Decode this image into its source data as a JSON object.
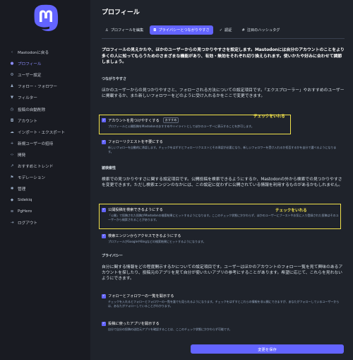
{
  "sidebar": {
    "back_label": "Mastodonに戻る",
    "items": [
      {
        "label": "プロフィール",
        "icon": "user-icon",
        "active": true
      },
      {
        "label": "ユーザー設定",
        "icon": "gear-icon"
      },
      {
        "label": "フォロー・フォロワー",
        "icon": "users-icon"
      },
      {
        "label": "フィルター",
        "icon": "filter-icon"
      },
      {
        "label": "投稿の自動削除",
        "icon": "history-icon"
      },
      {
        "label": "アカウント",
        "icon": "lock-icon"
      },
      {
        "label": "インポート・エクスポート",
        "icon": "cloud-icon"
      },
      {
        "label": "新規ユーザーの招待",
        "icon": "user-plus-icon"
      },
      {
        "label": "開発",
        "icon": "code-icon"
      },
      {
        "label": "おすすめとトレンド",
        "icon": "trend-icon"
      },
      {
        "label": "モデレーション",
        "icon": "flag-icon"
      },
      {
        "label": "管理",
        "icon": "cogs-icon"
      },
      {
        "label": "Sidekiq",
        "icon": "diamond-icon"
      },
      {
        "label": "PgHero",
        "icon": "database-icon"
      },
      {
        "label": "ログアウト",
        "icon": "sign-out-icon"
      }
    ]
  },
  "header": {
    "title": "プロフィール",
    "tabs": [
      {
        "label": "プロフィールを編集",
        "icon": "person-icon"
      },
      {
        "label": "プライバシーとつながりやすさ",
        "icon": "lock-icon",
        "active": true
      },
      {
        "label": "認証",
        "icon": "check-icon"
      },
      {
        "label": "注目のハッシュタグ",
        "icon": "hashtag-icon"
      }
    ]
  },
  "content": {
    "intro": "プロフィールの見えかたや、ほかのユーザーからの見つかりやすさを設定します。Mastodonには自分のアカウントのことをより多くの人に知ってもらうためのさまざまな機能があり、有効・無効をそれぞれ切り換えられます。使いかたや好みに合わせて調節しましょう。",
    "sections": {
      "reach": {
        "heading": "つながりやすさ",
        "desc": "ほかのユーザーからの見つかりやすさと、フォローされる方法についての設定項目です。「エクスプローラー」やおすすめのユーザーに掲載するか、また新しいフォロワーをどのように受け入れるかをここで変更できます。"
      },
      "discoverability": {
        "heading": "被検索性",
        "desc": "検索での見つかりやすさに関する設定項目です。公開投稿を検索できるようにするか、Mastodonの外から検索での見つかりやすさを変更できます。ただし検索エンジンのなかには、この設定に従わずに公開されている情報を利用するものがあるかもしれません。"
      },
      "privacy": {
        "heading": "プライバシー",
        "desc": "自分に関する情報をどの程度開示するかについての設定項目です。ユーザーはほかのアカウントのフォロー一覧を見て興味のあるアカウントを探したり、投稿元のアプリを見て自分が使いたいアプリの参考にすることがあります。希望に応じて、これらを見れないようにできます。"
      }
    },
    "options": [
      {
        "label": "アカウントを見つけやすくする",
        "badge": "おすすめ",
        "checked": true,
        "hint": "プロフィールと公開投稿をMastodonのおすすめやハイライトとしてほかのユーザーに表示することを許可します。"
      },
      {
        "label": "フォローリクエストを不要にする",
        "checked": true,
        "hint": "新しいフォローを自動的に承認します。チェックをはずすとフォローリクエストとその承認が必要になり、新しいフォロワーを受け入れるか拒否するかを自分で選べるようになります。"
      },
      {
        "label": "公開投稿を検索できるようにする",
        "checked": true,
        "hint": "「公開」で投稿された投稿がMastodonの検索結果にヒットするようになります。ここのチェック状態にかかわらず、ほかのユーザーにブーストやお気に入り登録された投稿はそのユーザーから検索されることがあります。"
      },
      {
        "label": "検索エンジンからアクセスできるようにする",
        "checked": true,
        "hint": "プロフィールがGoogleやBingなどの検索結果にヒットするようになります。"
      },
      {
        "label": "フォローとフォロワーの一覧を開示する",
        "checked": true,
        "hint": "チェックを入れるとフォローとフォロワーの一覧を誰でも見られるようになります。チェックをはずすとこれらの情報を非公開にできますが、あなたがフォローしているユーザーからは、あなたがフォローしていることがわかります。"
      },
      {
        "label": "投稿に使ったアプリを開示する",
        "checked": true,
        "hint": "自分で自分の投稿の送信元アプリを確認することは、ここのチェック状態にかかわらず可能です。"
      }
    ],
    "annotation": "チェックをいれる",
    "save_label": "変更を保存"
  },
  "colors": {
    "accent": "#6364ff",
    "highlight": "#f2e24a",
    "background": "#1f232b",
    "sidebar": "#191b22"
  }
}
